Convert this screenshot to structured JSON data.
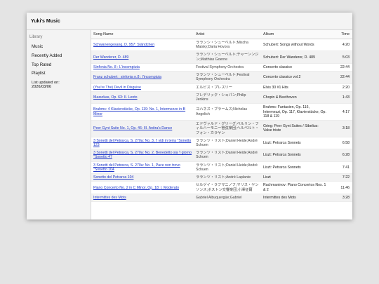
{
  "app": {
    "title": "Yuki's Music"
  },
  "sidebar": {
    "heading": "Library",
    "items": [
      {
        "label": "Music"
      },
      {
        "label": "Recently Added"
      },
      {
        "label": "Top Rated"
      },
      {
        "label": "Playlist"
      },
      {
        "label": "List updated on:\n2026/03/06"
      }
    ]
  },
  "table": {
    "headers": {
      "song": "Song Name",
      "artist": "Artist",
      "album": "Album",
      "time": "Time"
    },
    "rows": [
      {
        "song": "Schwanengesang, D. 957: Ständchen",
        "artist": "ラランシ・シューベルト;Mischa Maisky;Daria Hovora",
        "album": "Schubert: Songs without Words",
        "time": "4:20"
      },
      {
        "song": "Der Wanderer, D. 489",
        "artist": "ラランツ・シューベルト;チャーンンジン;Matthias Goerne",
        "album": "Schubert: Der Wanderer, D. 489",
        "time": "5:03"
      },
      {
        "song": "Sinfonia No. 8 : L'incompiuta",
        "artist": "Festival Symphony Orchestra",
        "album": "Concerto classico",
        "time": "22:44"
      },
      {
        "song": "Franz schubert : sinfonia n.8 : l'incompiuta",
        "artist": "ラランツ・シューベルト;Festival Symphony Orchestra",
        "album": "Concerto classico vol.2",
        "time": "22:44"
      },
      {
        "song": "(You're The) Devil in Disguise",
        "artist": "エルビス・プレスリー",
        "album": "Elvis 30 #1 Hits",
        "time": "2:20"
      },
      {
        "song": "Mazurkas, Op. 63: II. Lento",
        "artist": "フレデリック・ショパン;Philip Jenkins",
        "album": "Chopin & Beethoven",
        "time": "1:43"
      },
      {
        "song": "Brahms: 4 Klavierstücke, Op. 119: No. 1, Intermezzo in B Minor",
        "artist": "ヨハネス・ブラームス;Nicholas Angelich",
        "album": "Brahms: Fantasien, Op. 116, Intermezzi, Op. 117, Klavierstücke, Op. 118 & 119",
        "time": "4:17"
      },
      {
        "song": "Peer Gynt Suite No. 1, Op. 46: III. Anitra's Dance",
        "artist": "エドヴァルド・グリーグ;ベルリン・フィルハーモニー管弦楽団;ヘルベルト・フォン・カラヤン",
        "album": "Grieg: Peer Gynt Suites / Sibelius: Valse triste",
        "time": "3:18"
      },
      {
        "song": "3 Sonetti del Petrarca, S. 270a: No. 3, I' vidi in terra \"Sonetto 123",
        "artist": "ラランツ・リスト;Daniel Heide;André Schuen",
        "album": "Liszt: Petrarca Sonnets",
        "time": "6:58"
      },
      {
        "song": "3 Sonetti del Petrarca, S. 270a: No. 2, Benedetto sia 'l giorno \"Sonetto 47",
        "artist": "ラランツ・リスト;Daniel Heide;André Schuen",
        "album": "Liszt: Petrarca Sonnets",
        "time": "6:28"
      },
      {
        "song": "3 Sonetti del Petrarca, S. 270a: No. 1, Pace non trovo \"Sonetto 104",
        "artist": "ラランツ・リスト;Daniel Heide;André Schuen",
        "album": "Liszt: Petrarca Sonnets",
        "time": "7:41"
      },
      {
        "song": "Sonetto del Petrarca 104",
        "artist": "ラランツ・リスト;André Laplante",
        "album": "Liszt",
        "time": "7:22"
      },
      {
        "song": "Piano Concerto No. 2 in C Minor, Op. 18: I. Moderato",
        "artist": "セルゲイ・ラフマニノフ;マリス・ヤンソンス;ボストン交響楽団;小澤征爾",
        "album": "Rachmaninov: Piano Concertos Nos. 1 & 2",
        "time": "11:46"
      },
      {
        "song": "Intermittes des Mots",
        "artist": "Gabriel Albuquergüe;Gabriel",
        "album": "Intermittes des Mots",
        "time": "3:28"
      }
    ]
  }
}
